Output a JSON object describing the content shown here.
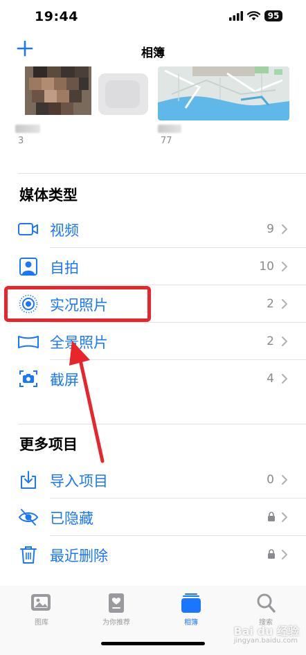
{
  "status_bar": {
    "time": "19:44",
    "battery": "95"
  },
  "nav": {
    "title": "相簿"
  },
  "albums": [
    {
      "count": "3"
    },
    {
      "count": "77"
    }
  ],
  "media_types": {
    "title": "媒体类型",
    "items": [
      {
        "label": "视频",
        "count": "9"
      },
      {
        "label": "自拍",
        "count": "10"
      },
      {
        "label": "实况照片",
        "count": "2"
      },
      {
        "label": "全景照片",
        "count": "2"
      },
      {
        "label": "截屏",
        "count": "4"
      }
    ]
  },
  "more_items": {
    "title": "更多项目",
    "items": [
      {
        "label": "导入项目",
        "count": "0"
      },
      {
        "label": "已隐藏",
        "count": ""
      },
      {
        "label": "最近删除",
        "count": ""
      }
    ]
  },
  "tab_bar": {
    "tabs": [
      {
        "label": "图库"
      },
      {
        "label": "为你推荐"
      },
      {
        "label": "相簿"
      },
      {
        "label": "搜索"
      }
    ]
  },
  "watermark": {
    "text": "Bai du 经验",
    "sub": "jingyan.baidu.com"
  },
  "colors": {
    "accent": "#1a76ff",
    "highlight": "#e8252b",
    "secondary": "#8a8a8e"
  }
}
